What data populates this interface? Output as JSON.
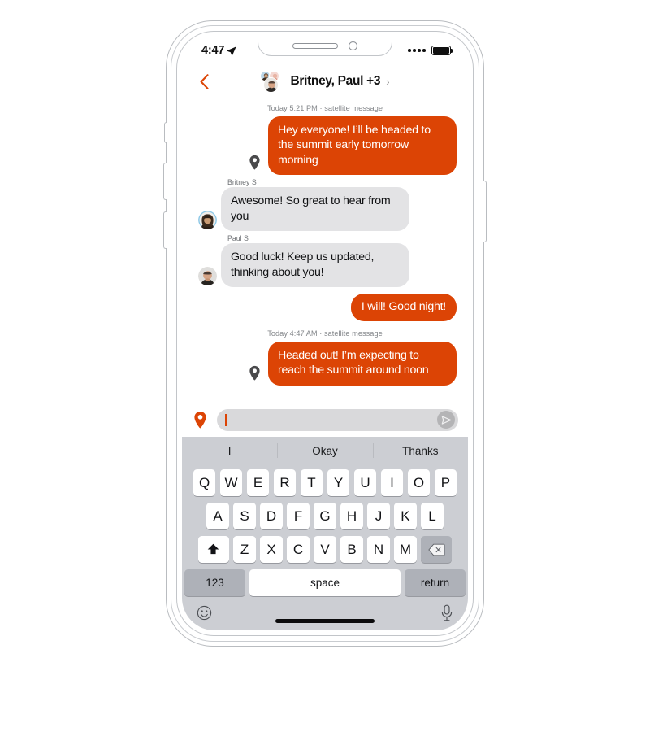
{
  "device": {
    "name": "smartphone",
    "status_bar": {
      "time": "4:47",
      "location_icon": "location-arrow-icon",
      "signal_icon": "signal-dots-icon",
      "battery_icon": "battery-full-icon"
    }
  },
  "nav": {
    "back_icon": "chevron-left-icon",
    "title": "Britney, Paul +3",
    "disclosure_icon": "chevron-right-icon",
    "avatar_icon": "group-avatar-icon"
  },
  "conversation": {
    "items": [
      {
        "kind": "system",
        "text": "Today 5:21 PM · satellite message"
      },
      {
        "kind": "sent",
        "text": "Hey everyone! I’ll be headed to the summit early tomorrow morning",
        "icon": "location-pin-icon"
      },
      {
        "kind": "received",
        "sender": "Britney S",
        "text": "Awesome! So great to hear from you",
        "avatar": "britney-avatar"
      },
      {
        "kind": "received",
        "sender": "Paul S",
        "text": "Good luck! Keep us updated, thinking about you!",
        "avatar": "paul-avatar"
      },
      {
        "kind": "sent_short",
        "text": "I will! Good night!"
      },
      {
        "kind": "system",
        "text": "Today 4:47 AM · satellite message"
      },
      {
        "kind": "sent",
        "text": "Headed out! I’m expecting to reach the summit around noon",
        "icon": "location-pin-icon"
      }
    ]
  },
  "composer": {
    "pin_icon": "location-pin-filled-icon",
    "value": "",
    "placeholder": "",
    "send_icon": "send-arrow-icon"
  },
  "keyboard": {
    "suggestions": [
      "I",
      "Okay",
      "Thanks"
    ],
    "row1": [
      "Q",
      "W",
      "E",
      "R",
      "T",
      "Y",
      "U",
      "I",
      "O",
      "P"
    ],
    "row2": [
      "A",
      "S",
      "D",
      "F",
      "G",
      "H",
      "J",
      "K",
      "L"
    ],
    "row3": [
      "Z",
      "X",
      "C",
      "V",
      "B",
      "N",
      "M"
    ],
    "shift_icon": "shift-up-arrow-icon",
    "backspace_icon": "backspace-delete-icon",
    "numbers_label": "123",
    "space_label": "space",
    "return_label": "return",
    "emoji_icon": "emoji-smiley-icon",
    "mic_icon": "microphone-icon"
  },
  "colors": {
    "accent_orange": "#DC4405",
    "received_bubble": "#e3e3e5",
    "keyboard_bg": "#ccced3",
    "key_white": "#ffffff",
    "key_grey": "#aeb1b8"
  }
}
